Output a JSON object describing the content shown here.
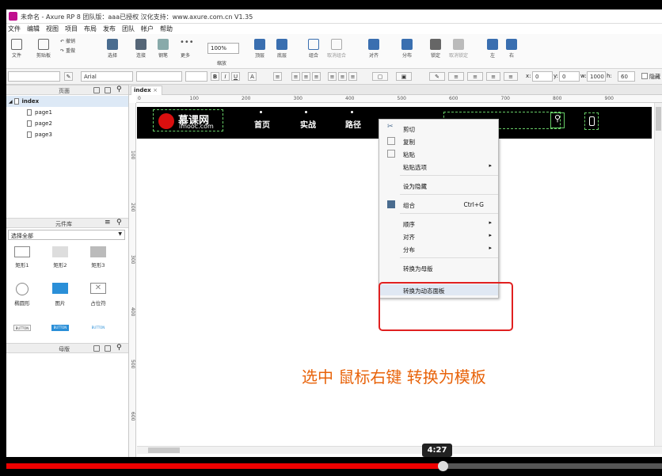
{
  "window": {
    "title": "未命名 - Axure RP 8 团队版：aaa已授权 汉化支持：www.axure.com.cn V1.35"
  },
  "menu": [
    "文件",
    "编辑",
    "视图",
    "项目",
    "布局",
    "发布",
    "团队",
    "帐户",
    "帮助"
  ],
  "toolbar": {
    "file": "文件",
    "clipboard": "剪贴板",
    "undo": "撤销",
    "redo": "重做",
    "select": "选择",
    "connect": "连接",
    "pen": "钢笔",
    "more": "更多",
    "zoom_value": "100%",
    "zoom": "缩放",
    "top": "顶层",
    "bottom": "底层",
    "group": "组合",
    "ungroup": "取消组合",
    "align": "对齐",
    "distribute": "分布",
    "lock": "锁定",
    "unlock": "取消锁定",
    "left": "左",
    "right": "右"
  },
  "format": {
    "font": "Arial",
    "x_label": "x:",
    "x": "0",
    "y_label": "y:",
    "y": "0",
    "w_label": "w:",
    "w": "1000",
    "h_label": "h:",
    "h": "60",
    "hide": "隐藏"
  },
  "pages_panel": {
    "title": "页面",
    "root": "index",
    "pages": [
      "page1",
      "page2",
      "page3"
    ]
  },
  "library_panel": {
    "title": "元件库",
    "select": "选择全部",
    "widgets": [
      "矩形1",
      "矩形2",
      "矩形3",
      "椭圆形",
      "图片",
      "占位符"
    ],
    "button_text": "BUTTON"
  },
  "masters_panel": {
    "title": "母版"
  },
  "canvas": {
    "tab": "index",
    "hruler": [
      "0",
      "100",
      "200",
      "300",
      "400",
      "500",
      "600",
      "700",
      "800",
      "900"
    ],
    "vruler": [
      "100",
      "200",
      "300",
      "400",
      "500",
      "600"
    ]
  },
  "site": {
    "brand_cn": "慕课网",
    "brand_en": "imooc.com",
    "nav": [
      "首页",
      "实战",
      "路径"
    ]
  },
  "context_menu": {
    "cut": "剪切",
    "copy": "复制",
    "paste": "粘贴",
    "paste_options": "粘贴选项",
    "hide": "设为隐藏",
    "group": "组合",
    "group_shortcut": "Ctrl+G",
    "order": "顺序",
    "align": "对齐",
    "distribute": "分布",
    "to_master": "转换为母版",
    "to_dynamic": "转换为动态面板"
  },
  "caption": "选中 鼠标右键 转换为模板",
  "video": {
    "time": "4:27",
    "progress": 0.665
  },
  "colors": {
    "accent": "#e8630a",
    "highlight": "#e02020",
    "brand": "#d90f0f"
  }
}
